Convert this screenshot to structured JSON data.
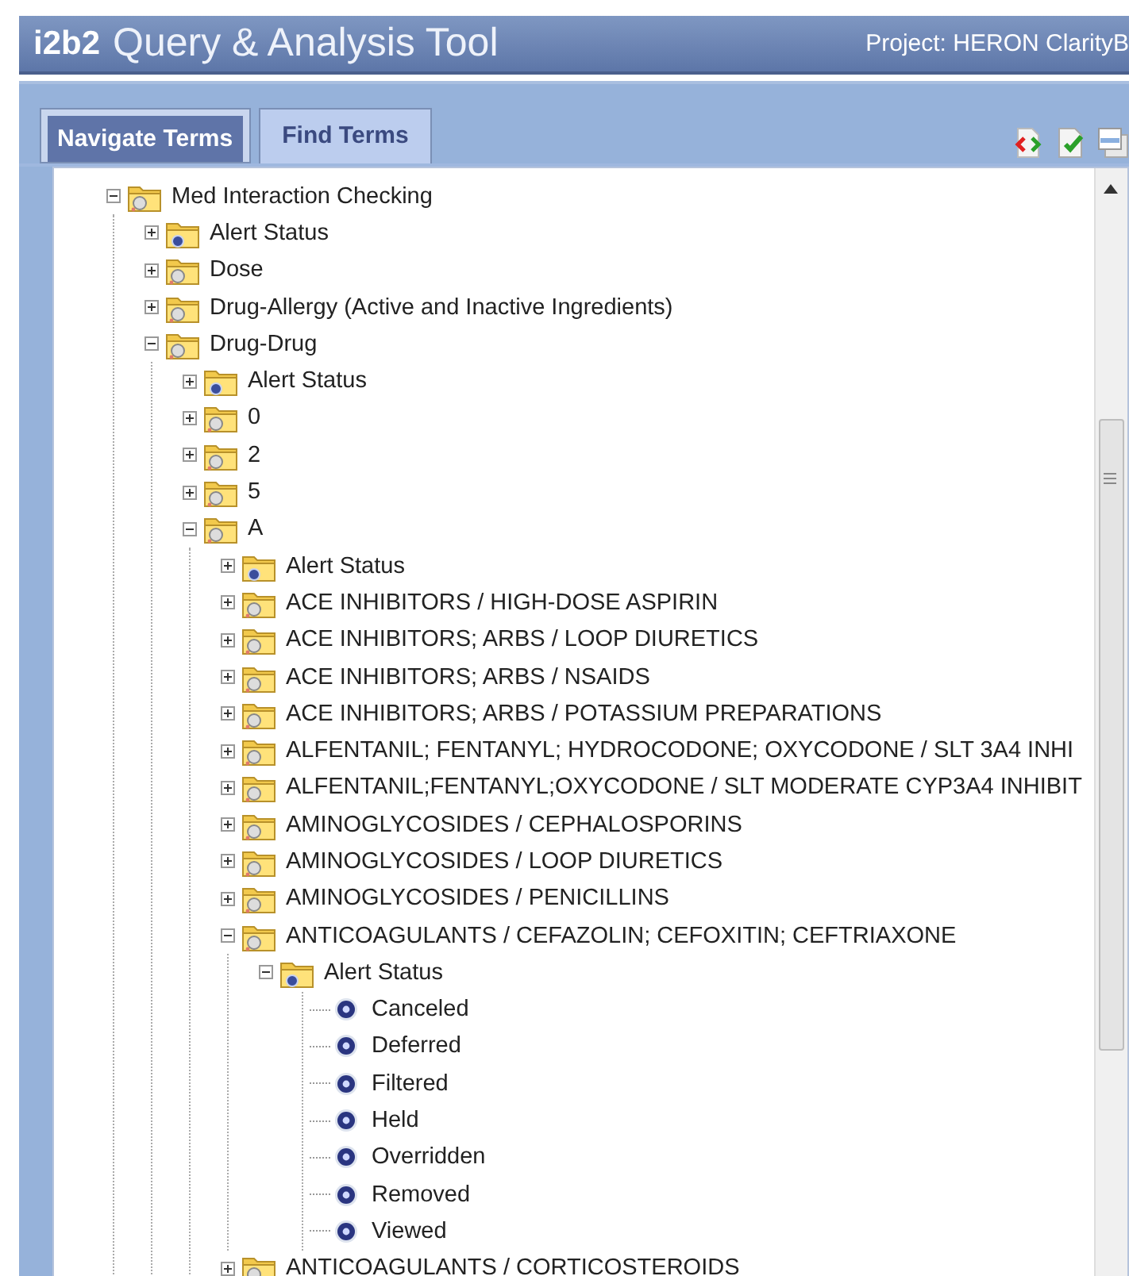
{
  "header": {
    "logo": "i2b2",
    "title": "Query & Analysis Tool",
    "project": "Project: HERON ClarityB"
  },
  "tabs": [
    {
      "label": "Navigate Terms",
      "selected": true
    },
    {
      "label": "Find Terms",
      "selected": false
    }
  ],
  "tree": [
    {
      "label": "Med Interaction Checking",
      "kind": "folder",
      "expanded": true,
      "children": [
        {
          "label": "Alert Status",
          "kind": "alert-folder",
          "expanded": false
        },
        {
          "label": "Dose",
          "kind": "folder",
          "expanded": false
        },
        {
          "label": "Drug-Allergy (Active and Inactive Ingredients)",
          "kind": "folder",
          "expanded": false
        },
        {
          "label": "Drug-Drug",
          "kind": "folder",
          "expanded": true,
          "children": [
            {
              "label": "Alert Status",
              "kind": "alert-folder",
              "expanded": false
            },
            {
              "label": "0",
              "kind": "folder",
              "expanded": false
            },
            {
              "label": "2",
              "kind": "folder",
              "expanded": false
            },
            {
              "label": "5",
              "kind": "folder",
              "expanded": false
            },
            {
              "label": "A",
              "kind": "folder",
              "expanded": true,
              "children": [
                {
                  "label": "Alert Status",
                  "kind": "alert-folder",
                  "expanded": false
                },
                {
                  "label": "ACE INHIBITORS / HIGH-DOSE ASPIRIN",
                  "kind": "folder",
                  "expanded": false
                },
                {
                  "label": "ACE INHIBITORS; ARBS / LOOP DIURETICS",
                  "kind": "folder",
                  "expanded": false
                },
                {
                  "label": "ACE INHIBITORS; ARBS / NSAIDS",
                  "kind": "folder",
                  "expanded": false
                },
                {
                  "label": "ACE INHIBITORS; ARBS / POTASSIUM PREPARATIONS",
                  "kind": "folder",
                  "expanded": false
                },
                {
                  "label": "ALFENTANIL; FENTANYL; HYDROCODONE; OXYCODONE / SLT 3A4 INHI",
                  "kind": "folder",
                  "expanded": false
                },
                {
                  "label": "ALFENTANIL;FENTANYL;OXYCODONE / SLT MODERATE CYP3A4 INHIBIT",
                  "kind": "folder",
                  "expanded": false
                },
                {
                  "label": "AMINOGLYCOSIDES / CEPHALOSPORINS",
                  "kind": "folder",
                  "expanded": false
                },
                {
                  "label": "AMINOGLYCOSIDES / LOOP DIURETICS",
                  "kind": "folder",
                  "expanded": false
                },
                {
                  "label": "AMINOGLYCOSIDES / PENICILLINS",
                  "kind": "folder",
                  "expanded": false
                },
                {
                  "label": "ANTICOAGULANTS / CEFAZOLIN; CEFOXITIN; CEFTRIAXONE",
                  "kind": "folder",
                  "expanded": true,
                  "children": [
                    {
                      "label": "Alert Status",
                      "kind": "alert-folder",
                      "expanded": true,
                      "children": [
                        {
                          "label": "Canceled",
                          "kind": "leaf"
                        },
                        {
                          "label": "Deferred",
                          "kind": "leaf"
                        },
                        {
                          "label": "Filtered",
                          "kind": "leaf"
                        },
                        {
                          "label": "Held",
                          "kind": "leaf"
                        },
                        {
                          "label": "Overridden",
                          "kind": "leaf"
                        },
                        {
                          "label": "Removed",
                          "kind": "leaf"
                        },
                        {
                          "label": "Viewed",
                          "kind": "leaf"
                        }
                      ]
                    }
                  ]
                },
                {
                  "label": "ANTICOAGULANTS / CORTICOSTEROIDS",
                  "kind": "folder",
                  "expanded": false
                }
              ]
            }
          ]
        }
      ]
    }
  ]
}
